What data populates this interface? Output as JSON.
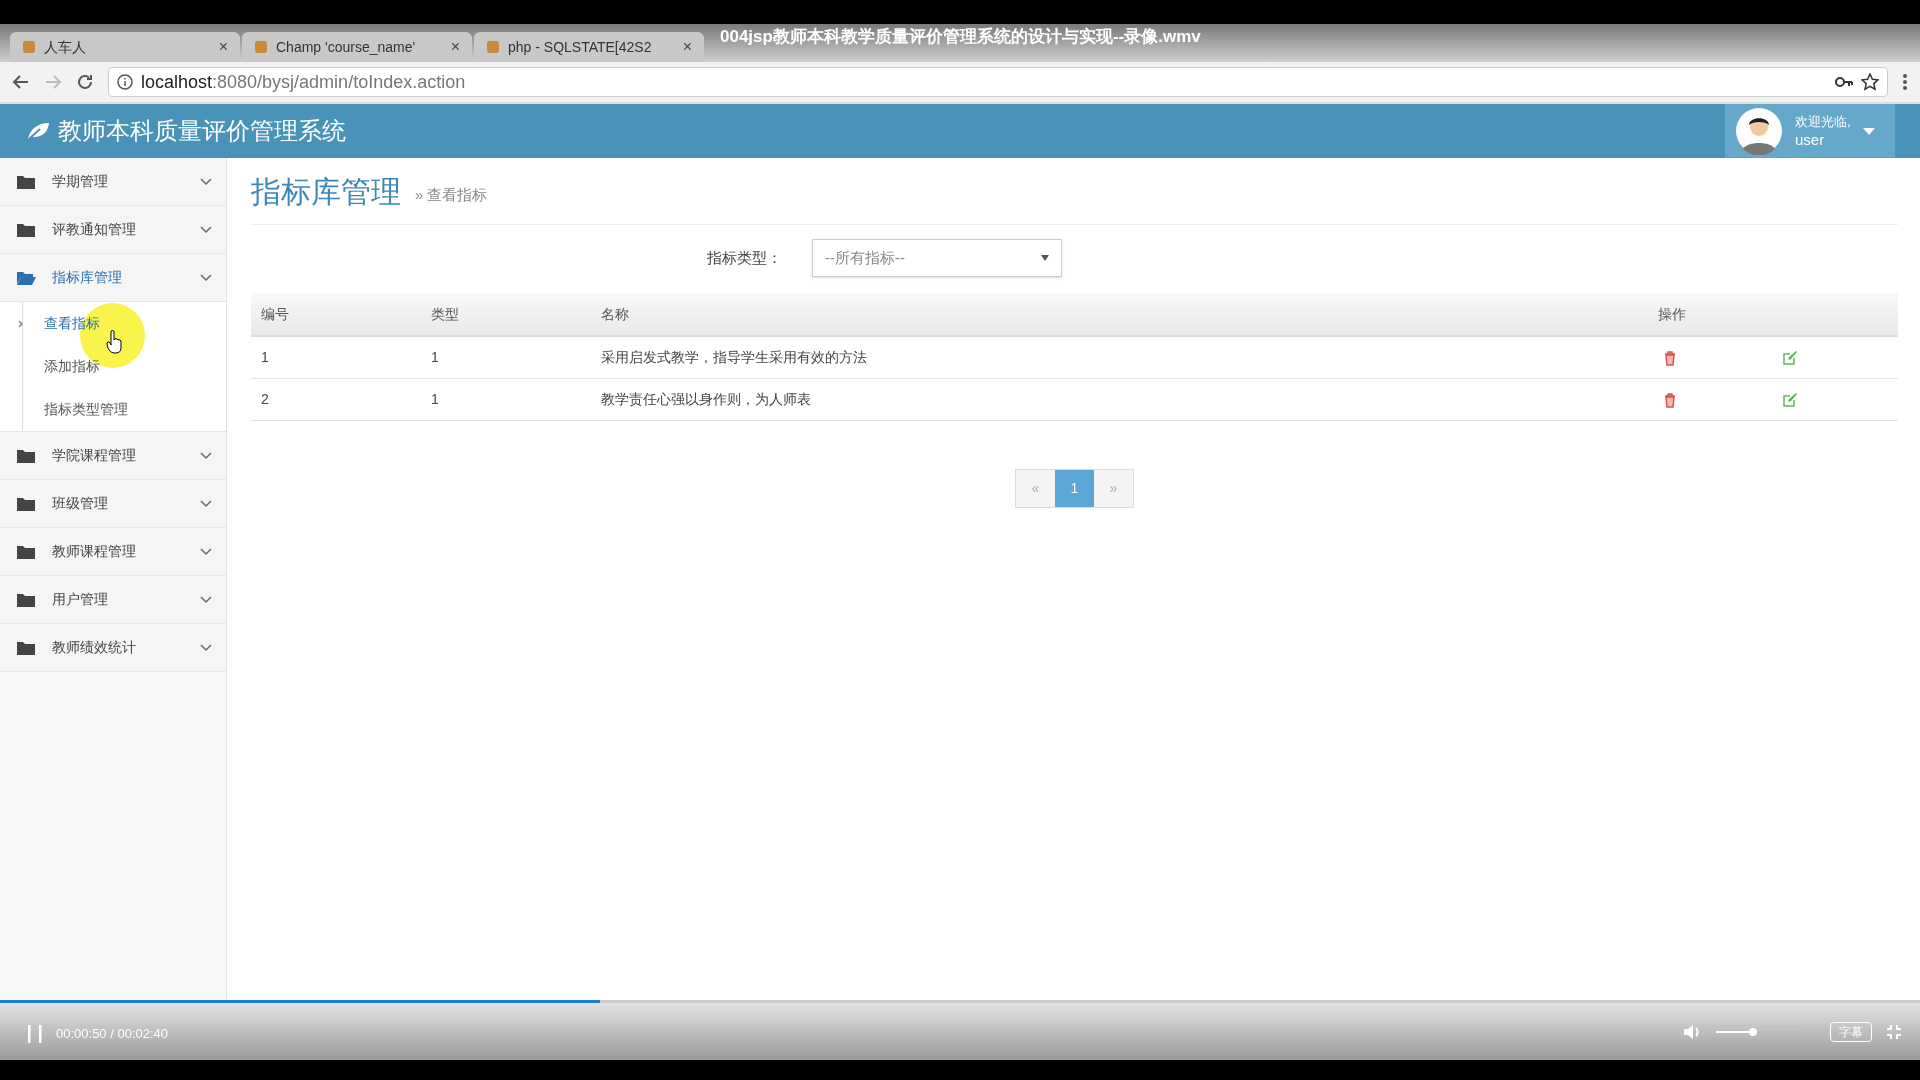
{
  "video": {
    "title": "004jsp教师本科教学质量评价管理系统的设计与实现--录像.wmv",
    "playing": true,
    "time": "00:00:50 / 00:02:40",
    "progress": {
      "level": 0.3125
    },
    "volume": {
      "level": 0.41
    },
    "subtitle_button": "字幕"
  },
  "browser": {
    "tabs": [
      {
        "label": "人车人",
        "close": "×"
      },
      {
        "label": "Champ 'course_name'",
        "close": "×"
      },
      {
        "label": "php - SQLSTATE[42S2",
        "close": "×"
      }
    ],
    "url_host": "localhost",
    "url_rest": ":8080/bysj/admin/toIndex.action"
  },
  "app": {
    "title": "教师本科质量评价管理系统",
    "user": {
      "greeting": "欢迎光临,",
      "name": "user"
    }
  },
  "sidebar": {
    "items": [
      {
        "label": "学期管理",
        "expanded": false
      },
      {
        "label": "评教通知管理",
        "expanded": false
      },
      {
        "label": "指标库管理",
        "expanded": true,
        "children": [
          {
            "label": "查看指标",
            "selected": true
          },
          {
            "label": "添加指标",
            "selected": false
          },
          {
            "label": "指标类型管理",
            "selected": false
          }
        ]
      },
      {
        "label": "学院课程管理",
        "expanded": false
      },
      {
        "label": "班级管理",
        "expanded": false
      },
      {
        "label": "教师课程管理",
        "expanded": false
      },
      {
        "label": "用户管理",
        "expanded": false
      },
      {
        "label": "教师绩效统计",
        "expanded": false
      }
    ]
  },
  "page": {
    "title": "指标库管理",
    "breadcrumb_separator": "»",
    "breadcrumb": "查看指标"
  },
  "filter": {
    "label": "指标类型：",
    "value": "--所有指标--"
  },
  "table": {
    "columns": [
      "编号",
      "类型",
      "名称",
      "操作"
    ],
    "rows": [
      {
        "cells": [
          "1",
          "1",
          "采用启发式教学，指导学生采用有效的方法"
        ]
      },
      {
        "cells": [
          "2",
          "1",
          "教学责任心强以身作则，为人师表"
        ]
      }
    ]
  },
  "pagination": [
    {
      "label": "«",
      "selected": false
    },
    {
      "label": "1",
      "selected": true
    },
    {
      "label": "»",
      "selected": false
    }
  ]
}
